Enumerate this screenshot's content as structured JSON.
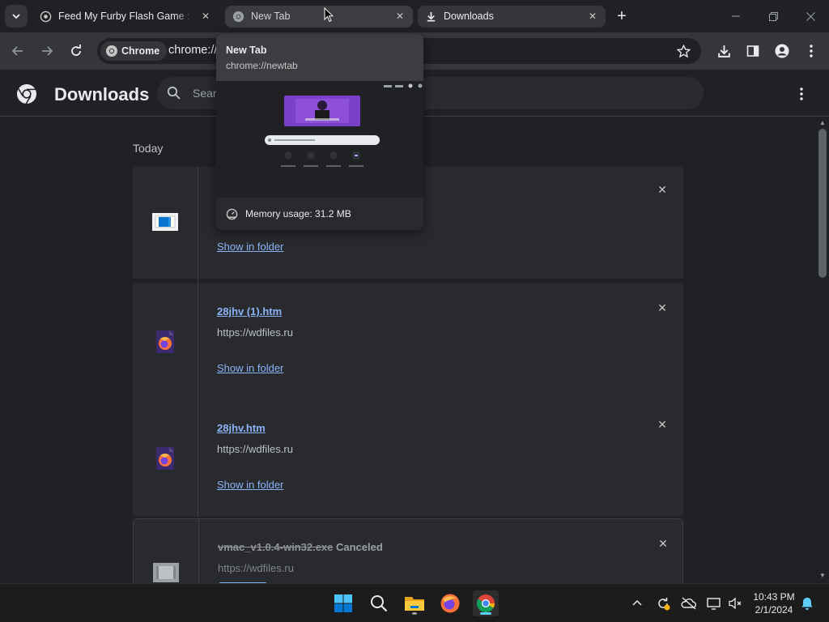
{
  "tabs": [
    {
      "title": "Feed My Furby Flash Game : Fre",
      "favicon": "archive-icon",
      "active": false
    },
    {
      "title": "New Tab",
      "favicon": "chrome-icon",
      "active": false,
      "hovered": true
    },
    {
      "title": "Downloads",
      "favicon": "download-icon",
      "active": true
    }
  ],
  "toolbar": {
    "chip_label": "Chrome",
    "url": "chrome://downloads"
  },
  "header": {
    "title": "Downloads",
    "search_placeholder": "Search downloads"
  },
  "date_group": "Today",
  "downloads": [
    {
      "filename": "",
      "source": "",
      "show_in_folder": "Show in folder",
      "icon": "image-file-icon"
    },
    {
      "filename": "28jhv (1).htm",
      "source": "https://wdfiles.ru",
      "show_in_folder": "Show in folder",
      "icon": "firefox-file-icon"
    },
    {
      "filename": "28jhv.htm",
      "source": "https://wdfiles.ru",
      "show_in_folder": "Show in folder",
      "icon": "firefox-file-icon"
    },
    {
      "filename": "vmac_v1.0.4-win32.exe",
      "status": "Canceled",
      "source": "https://wdfiles.ru",
      "icon": "exe-file-icon"
    }
  ],
  "hover_card": {
    "title": "New Tab",
    "url": "chrome://newtab",
    "memory": "Memory usage: 31.2 MB"
  },
  "taskbar": {
    "apps": [
      "start-icon",
      "search-icon",
      "file-explorer-icon",
      "firefox-icon",
      "chrome-icon"
    ],
    "time": "10:43 PM",
    "date": "2/1/2024"
  },
  "colors": {
    "background": "#202124",
    "card": "#292a2d",
    "link": "#8ab4f8",
    "accent_blue": "#60cdff"
  }
}
